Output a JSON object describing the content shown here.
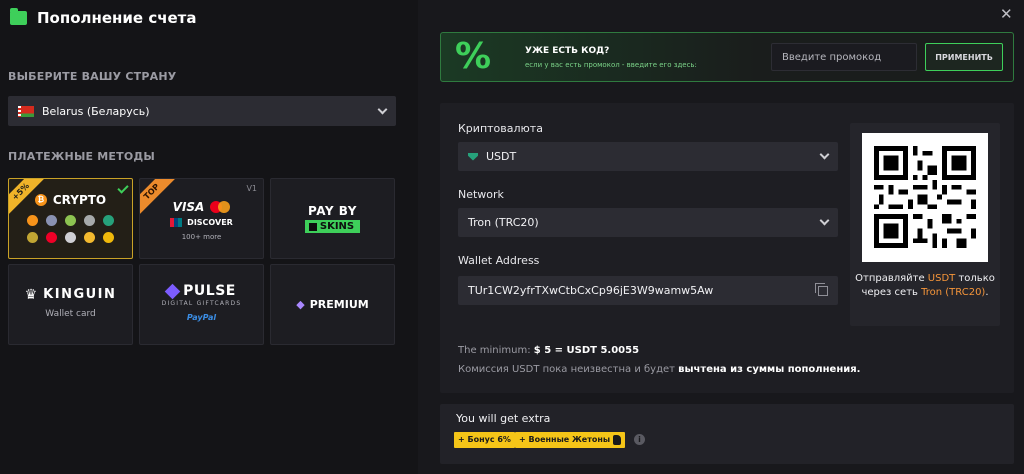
{
  "header": {
    "title": "Пополнение счета"
  },
  "country": {
    "label": "ВЫБЕРИТЕ ВАШУ СТРАНУ",
    "selected": "Belarus (Беларусь)"
  },
  "methods": {
    "label": "ПЛАТЕЖНЫЕ МЕТОДЫ",
    "crypto": {
      "badge": "+5%",
      "name": "CRYPTO"
    },
    "cards": {
      "badge": "TOP",
      "version": "V1",
      "visa": "VISA",
      "discover": "DISCOVER",
      "more": "100+ more"
    },
    "payby": {
      "top": "PAY BY",
      "skins": "SKINS"
    },
    "kinguin": {
      "name": "KINGUIN",
      "sub": "Wallet card"
    },
    "pulse": {
      "name": "PULSE",
      "sub": "DIGITAL GIFTCARDS",
      "paypal": "PayPal"
    },
    "premium": {
      "name": "PREMIUM"
    }
  },
  "promo": {
    "title": "УЖЕ ЕСТЬ КОД?",
    "subtitle": "если у вас есть промокол - введите его здесь:",
    "placeholder": "Введите промокод",
    "apply": "ПРИМЕНИТЬ"
  },
  "form": {
    "currency_label": "Криптовалюта",
    "currency_value": "USDT",
    "network_label": "Network",
    "network_value": "Tron (TRC20)",
    "wallet_label": "Wallet Address",
    "wallet_value": "TUr1CW2yfrTXwCtbCxCp96jE3W9wamw5Aw"
  },
  "qr": {
    "caption_pre": "Отправляйте ",
    "caption_coin": "USDT",
    "caption_mid": " только через сеть ",
    "caption_net": "Tron (TRC20)",
    "caption_end": "."
  },
  "info": {
    "min_label": "The minimum: ",
    "min_value": "$ 5 = USDT 5.0055",
    "fee_text": "Комиссия USDT пока неизвестна и будет ",
    "fee_bold": "вычтена из суммы пополнения."
  },
  "extra": {
    "title": "You will get extra",
    "bonus": "+ Бонус 6%",
    "tokens": "+ Военные Жетоны"
  },
  "colors": {
    "accent_green": "#3ecf5a",
    "highlight_orange": "#f5953a",
    "badge_yellow": "#f5c518",
    "crypto_border": "#c9a227"
  },
  "icons": [
    "folder-icon",
    "flag-belarus-icon",
    "chevron-down-icon",
    "check-icon",
    "bitcoin-icon",
    "usdt-icon",
    "copy-icon",
    "close-icon",
    "qr-code",
    "crown-icon",
    "gem-icon",
    "token-icon",
    "info-icon"
  ]
}
